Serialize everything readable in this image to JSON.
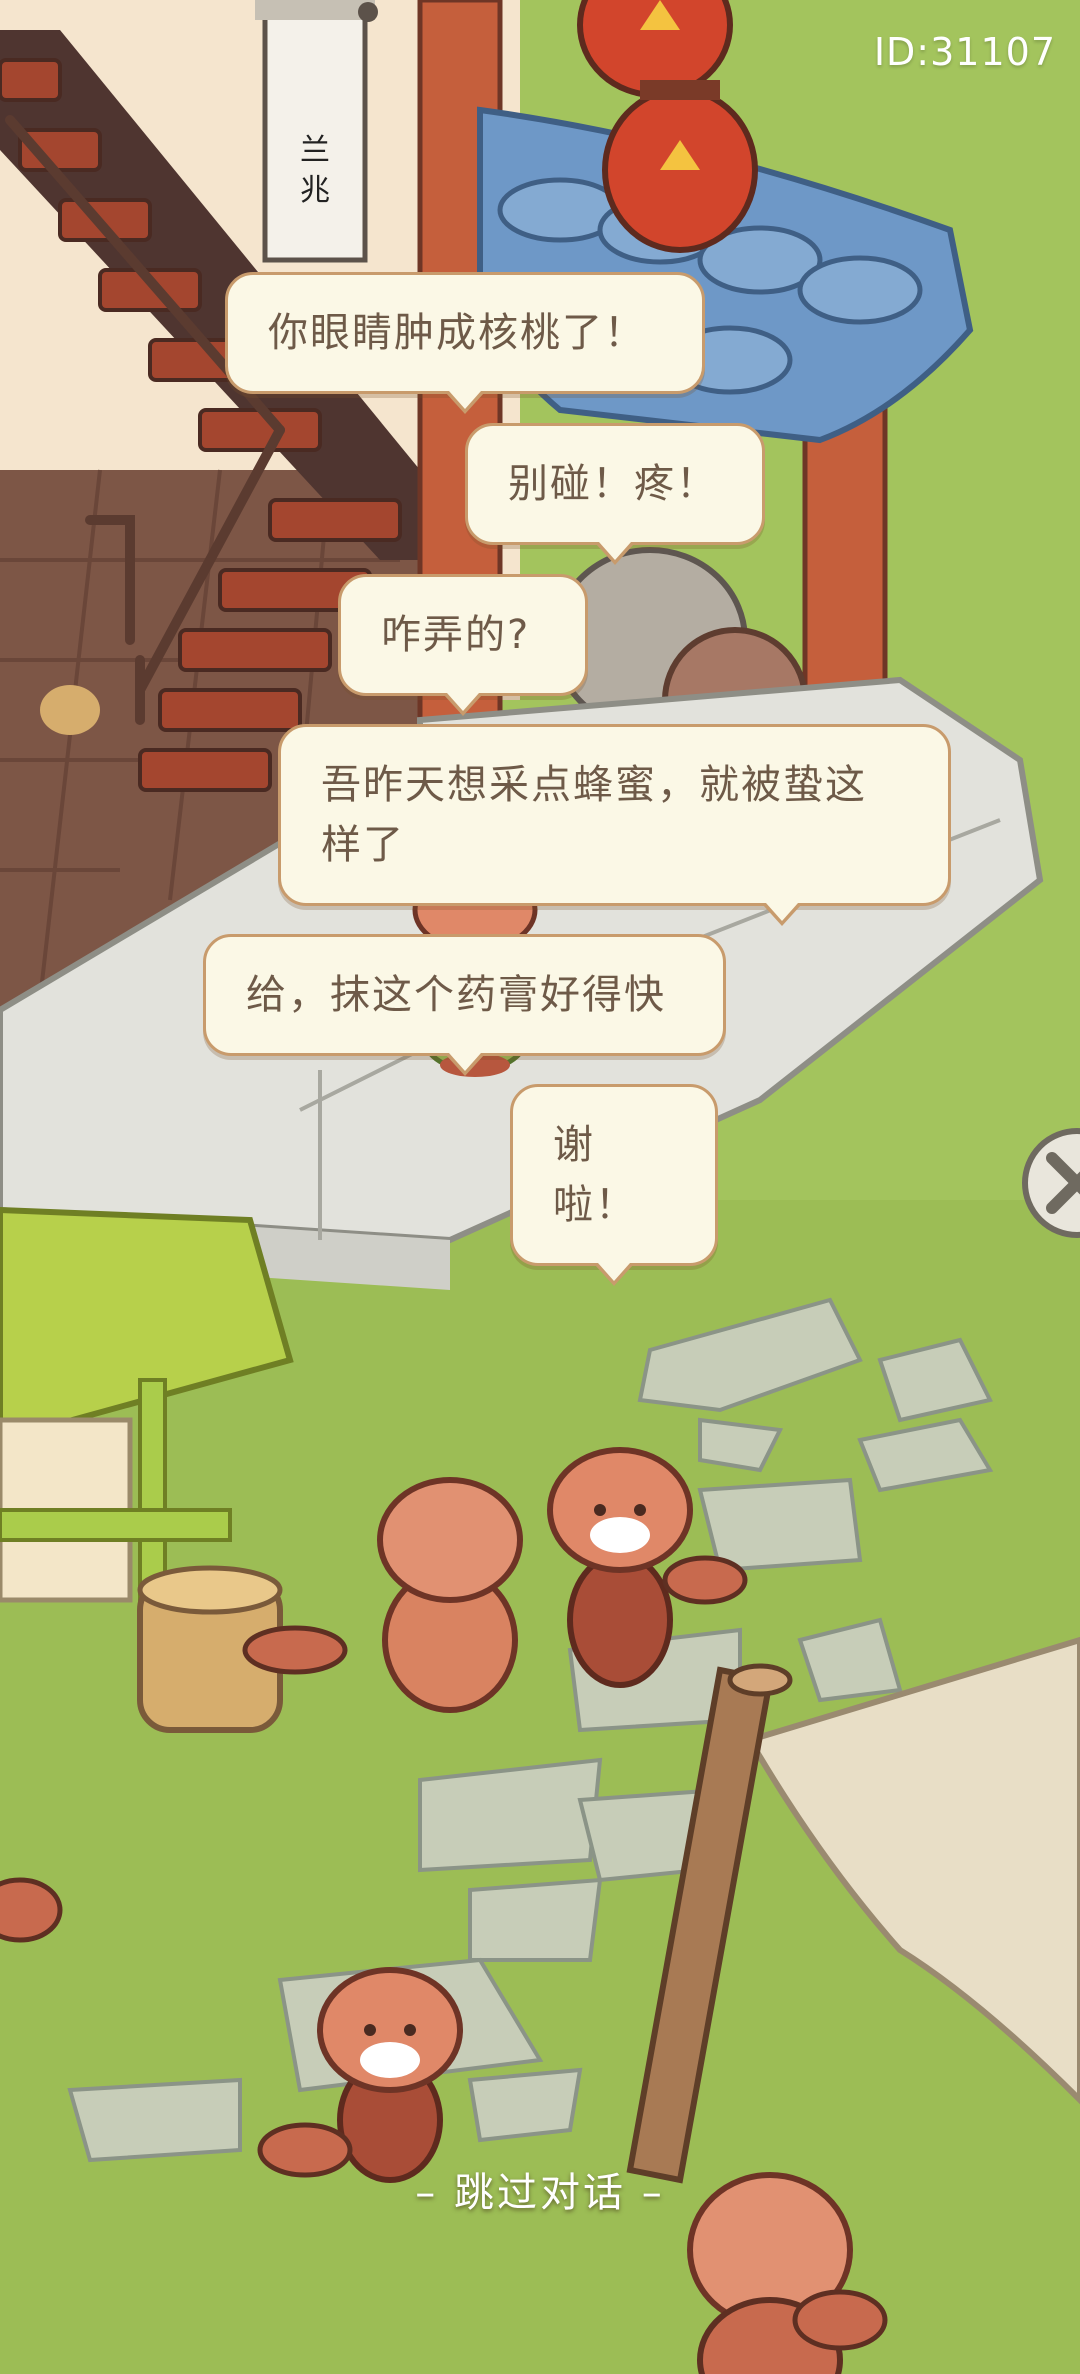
{
  "player": {
    "id_text": "ID:31107"
  },
  "dialogue": [
    {
      "text": "你眼睛肿成核桃了！"
    },
    {
      "text": "别碰！疼！"
    },
    {
      "text": "咋弄的?"
    },
    {
      "text": "吾昨天想采点蜂蜜，就被蛰这样了"
    },
    {
      "text": "给，抹这个药膏好得快"
    },
    {
      "text": "谢啦！"
    }
  ],
  "controls": {
    "skip_label": "– 跳过对话 –",
    "close_icon": "close-icon"
  },
  "scroll": {
    "calligraphy": "兰兆"
  }
}
